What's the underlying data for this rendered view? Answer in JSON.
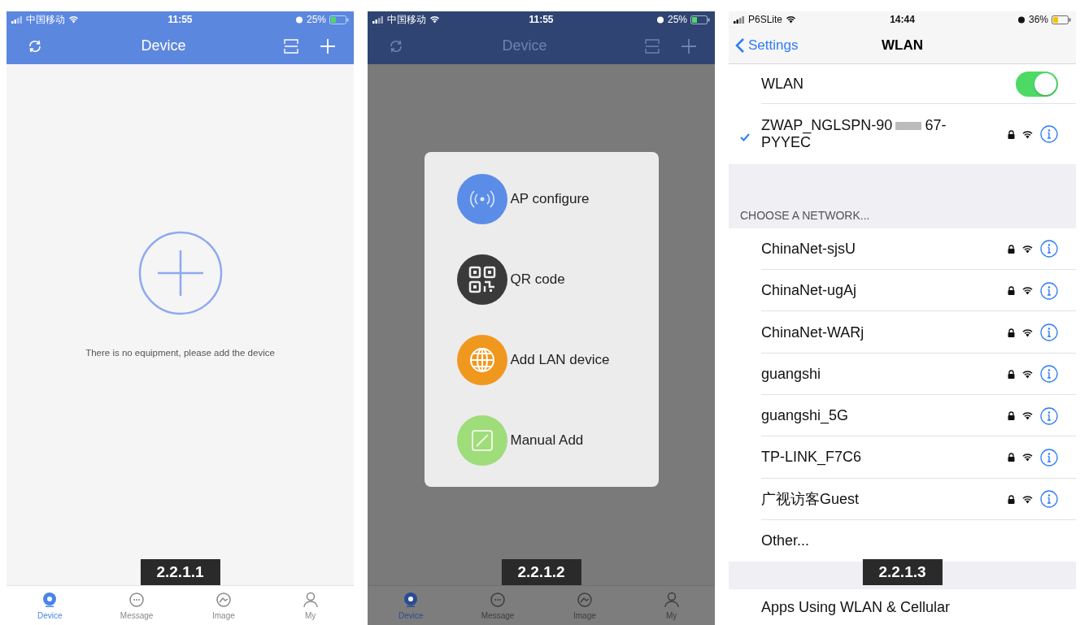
{
  "screens": [
    {
      "kind": "device_empty",
      "figure_label": "2.2.1.1",
      "status_bar": {
        "carrier": "中国移动",
        "time": "11:55",
        "battery": "25%"
      },
      "header": {
        "title": "Device"
      },
      "empty_text": "There is no equipment, please add the device",
      "tabs": [
        {
          "label": "Device",
          "selected": true
        },
        {
          "label": "Message",
          "selected": false
        },
        {
          "label": "Image",
          "selected": false
        },
        {
          "label": "My",
          "selected": false
        }
      ]
    },
    {
      "kind": "device_menu",
      "figure_label": "2.2.1.2",
      "status_bar": {
        "carrier": "中国移动",
        "time": "11:55",
        "battery": "25%"
      },
      "header": {
        "title": "Device"
      },
      "menu": [
        {
          "kind": "ap",
          "label": "AP configure",
          "color": "#5b8de8"
        },
        {
          "kind": "qr",
          "label": "QR code",
          "color": "#3a3a3a"
        },
        {
          "kind": "lan",
          "label": "Add LAN device",
          "color": "#f0981e"
        },
        {
          "kind": "manual",
          "label": "Manual Add",
          "color": "#9fdc7a"
        }
      ],
      "tabs": [
        {
          "label": "Device",
          "selected": true
        },
        {
          "label": "Message",
          "selected": false
        },
        {
          "label": "Image",
          "selected": false
        },
        {
          "label": "My",
          "selected": false
        }
      ]
    },
    {
      "kind": "wlan",
      "figure_label": "2.2.1.3",
      "status_bar": {
        "carrier": "P6SLite",
        "time": "14:44",
        "battery": "36%"
      },
      "back": "Settings",
      "title": "WLAN",
      "toggle": {
        "label": "WLAN",
        "on": true
      },
      "connected": {
        "name_start": "ZWAP_NGLSPN-90",
        "name_end": "67-PYYEC",
        "selected": true
      },
      "section": "CHOOSE A NETWORK...",
      "networks": [
        "ChinaNet-sjsU",
        "ChinaNet-ugAj",
        "ChinaNet-WARj",
        "guangshi",
        "guangshi_5G",
        "TP-LINK_F7C6",
        "广视访客Guest"
      ],
      "other": "Other...",
      "apps_row": "Apps Using WLAN & Cellular"
    }
  ]
}
